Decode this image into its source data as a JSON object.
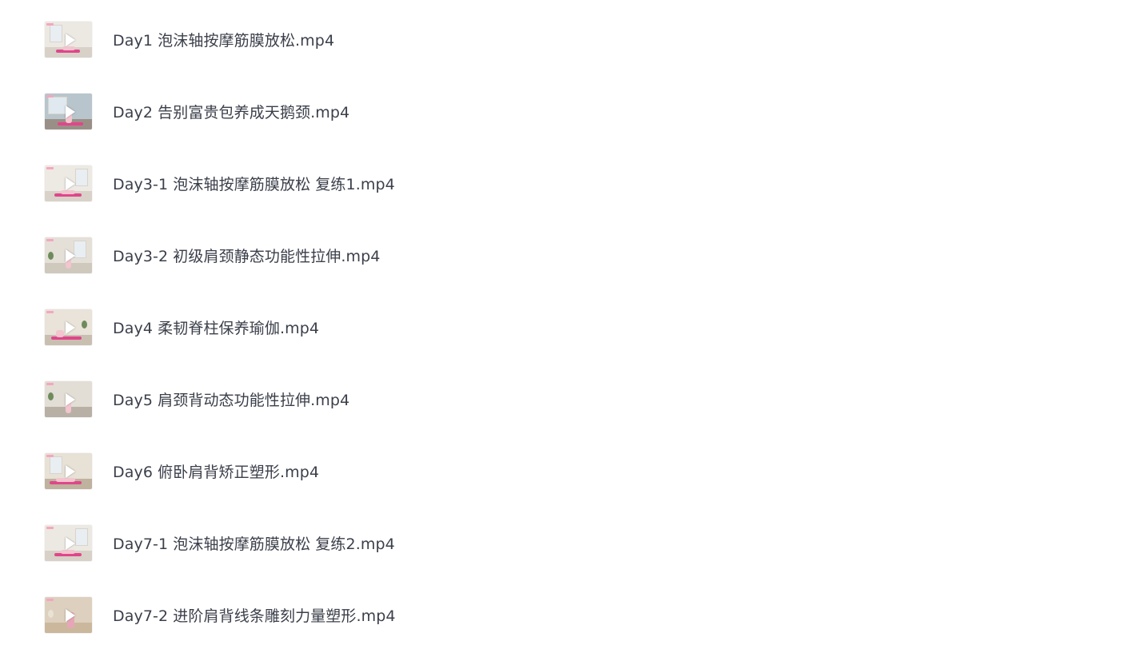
{
  "files": [
    {
      "name": "Day1 泡沫轴按摩筋膜放松.mp4",
      "thumbnail": {
        "wall": "#ece8e2",
        "floor": "#d7d1c8",
        "accent": "#e0468a",
        "scene": "room-with-window"
      }
    },
    {
      "name": "Day2 告别富贵包养成天鹅颈.mp4",
      "thumbnail": {
        "wall": "#b9c5cc",
        "floor": "#9a8f86",
        "accent": "#e0468a",
        "scene": "window-sea-view"
      }
    },
    {
      "name": "Day3-1 泡沫轴按摩筋膜放松 复练1.mp4",
      "thumbnail": {
        "wall": "#ede9e3",
        "floor": "#d8d2c9",
        "accent": "#e0468a",
        "scene": "room-with-window"
      }
    },
    {
      "name": "Day3-2 初级肩颈静态功能性拉伸.mp4",
      "thumbnail": {
        "wall": "#e4e0d8",
        "floor": "#cfc8bd",
        "accent": "#e0468a",
        "scene": "room-with-plant"
      }
    },
    {
      "name": "Day4 柔韧脊柱保养瑜伽.mp4",
      "thumbnail": {
        "wall": "#e9e3d9",
        "floor": "#c9bfb1",
        "accent": "#e0468a",
        "scene": "room-with-plant"
      }
    },
    {
      "name": "Day5 肩颈背动态功能性拉伸.mp4",
      "thumbnail": {
        "wall": "#e2ddd5",
        "floor": "#b8b0a5",
        "accent": "#e0468a",
        "scene": "room-with-plant"
      }
    },
    {
      "name": "Day6 俯卧肩背矫正塑形.mp4",
      "thumbnail": {
        "wall": "#e7e1d6",
        "floor": "#bfb29e",
        "accent": "#e0468a",
        "scene": "room-with-window"
      }
    },
    {
      "name": "Day7-1 泡沫轴按摩筋膜放松  复练2.mp4",
      "thumbnail": {
        "wall": "#ece8e2",
        "floor": "#d7d1c8",
        "accent": "#e0468a",
        "scene": "room-with-window"
      }
    },
    {
      "name": "Day7-2 进阶肩背线条雕刻力量塑形.mp4",
      "thumbnail": {
        "wall": "#ddd0be",
        "floor": "#cbb79c",
        "accent": "#e0468a",
        "scene": "room-with-plant"
      }
    }
  ],
  "icons": {
    "play": "play-icon",
    "video_file": "video-thumbnail"
  }
}
